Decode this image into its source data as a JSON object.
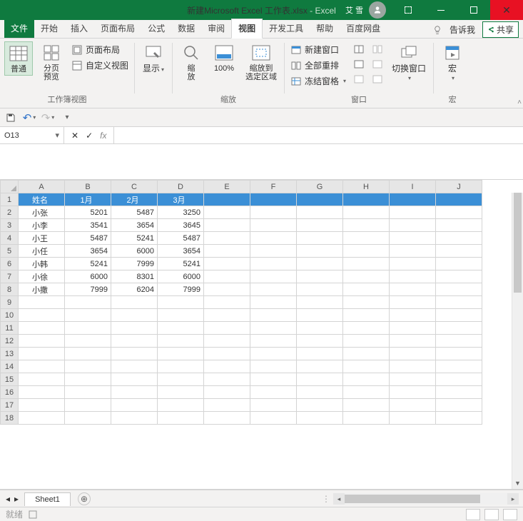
{
  "title": {
    "doc": "新建Microsoft Excel 工作表.xlsx",
    "sep": " - ",
    "app": "Excel"
  },
  "user": "艾 雪",
  "tabs": {
    "file": "文件",
    "list": [
      "开始",
      "插入",
      "页面布局",
      "公式",
      "数据",
      "审阅",
      "视图",
      "开发工具",
      "帮助",
      "百度网盘"
    ],
    "active": "视图",
    "tell": "告诉我",
    "share": "共享"
  },
  "ribbon": {
    "views": {
      "normal": "普通",
      "pagebreak": "分页\n预览",
      "layout": "页面布局",
      "custom": "自定义视图",
      "label": "工作簿视图"
    },
    "show": {
      "btn": "显示",
      "label": ""
    },
    "zoom": {
      "zoom": "缩\n放",
      "hundred": "100%",
      "tosel": "缩放到\n选定区域",
      "label": "缩放"
    },
    "window": {
      "newwin": "新建窗口",
      "arrange": "全部重排",
      "freeze": "冻结窗格",
      "switch": "切换窗口",
      "label": "窗口"
    },
    "macro": {
      "btn": "宏",
      "label": "宏"
    }
  },
  "namebox": "O13",
  "columns": [
    "A",
    "B",
    "C",
    "D",
    "E",
    "F",
    "G",
    "H",
    "I",
    "J"
  ],
  "header_row": [
    "姓名",
    "1月",
    "2月",
    "3月"
  ],
  "data_rows": [
    [
      "小张",
      "5201",
      "5487",
      "3250"
    ],
    [
      "小李",
      "3541",
      "3654",
      "3645"
    ],
    [
      "小王",
      "5487",
      "5241",
      "5487"
    ],
    [
      "小任",
      "3654",
      "6000",
      "3654"
    ],
    [
      "小韩",
      "5241",
      "7999",
      "5241"
    ],
    [
      "小徐",
      "6000",
      "8301",
      "6000"
    ],
    [
      "小撒",
      "7999",
      "6204",
      "7999"
    ]
  ],
  "sheet": "Sheet1",
  "status": "就绪"
}
